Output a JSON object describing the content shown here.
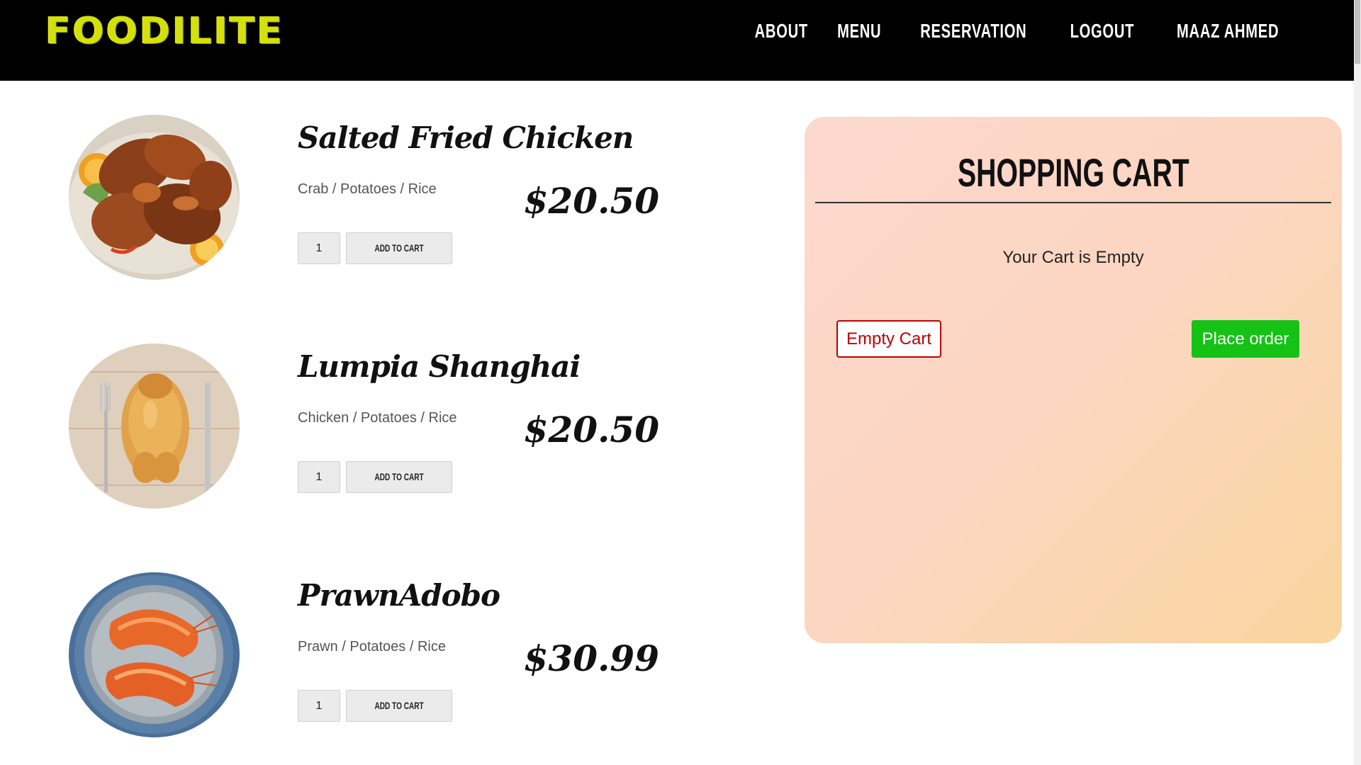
{
  "brand": {
    "logo": "FOODILITE",
    "logo_color": "#d4e00a"
  },
  "nav": {
    "items": [
      {
        "label": "ABOUT"
      },
      {
        "label": "MENU"
      },
      {
        "label": "RESERVATION"
      },
      {
        "label": "LOGOUT"
      },
      {
        "label": "MAAZ AHMED"
      }
    ]
  },
  "menu": {
    "items": [
      {
        "name": "Salted Fried Chicken",
        "description": "Crab / Potatoes / Rice",
        "price": "$20.50",
        "quantity": "1",
        "add_label": "ADD TO CART",
        "image_icon": "roasted-chicken-plate-image"
      },
      {
        "name": "Lumpia Shanghai",
        "description": "Chicken / Potatoes / Rice",
        "price": "$20.50",
        "quantity": "1",
        "add_label": "ADD TO CART",
        "image_icon": "whole-roast-chicken-image"
      },
      {
        "name": "PrawnAdobo",
        "description": "Prawn / Potatoes / Rice",
        "price": "$30.99",
        "quantity": "1",
        "add_label": "ADD TO CART",
        "image_icon": "prawn-plate-image"
      }
    ]
  },
  "cart": {
    "title": "SHOPPING CART",
    "empty_message": "Your Cart is Empty",
    "empty_button": "Empty Cart",
    "order_button": "Place order",
    "colors": {
      "empty_button": "#c00000",
      "order_button": "#15c215"
    }
  }
}
